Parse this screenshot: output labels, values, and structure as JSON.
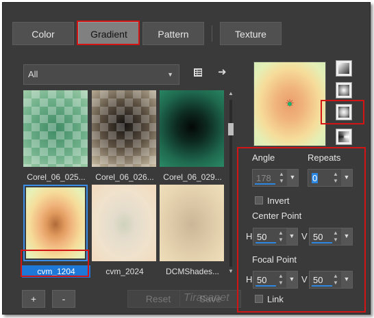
{
  "tabs": [
    {
      "label": "Color"
    },
    {
      "label": "Gradient"
    },
    {
      "label": "Pattern"
    },
    {
      "label": "Texture"
    }
  ],
  "filter": {
    "value": "All"
  },
  "thumbnails": [
    {
      "label": "Corel_06_025..."
    },
    {
      "label": "Corel_06_026..."
    },
    {
      "label": "Corel_06_029..."
    },
    {
      "label": "cvm_1204"
    },
    {
      "label": "cvm_2024"
    },
    {
      "label": "DCMShades..."
    }
  ],
  "buttons": {
    "add": "+",
    "remove": "-",
    "reset": "Reset",
    "save": "Save"
  },
  "properties": {
    "angle_label": "Angle",
    "angle_value": "178",
    "repeats_label": "Repeats",
    "repeats_value": "0",
    "invert_label": "Invert",
    "center_label": "Center Point",
    "focal_label": "Focal Point",
    "h_label": "H",
    "v_label": "V",
    "center_h": "50",
    "center_v": "50",
    "focal_h": "50",
    "focal_v": "50",
    "link_label": "Link"
  },
  "watermark": "Tirasanet"
}
